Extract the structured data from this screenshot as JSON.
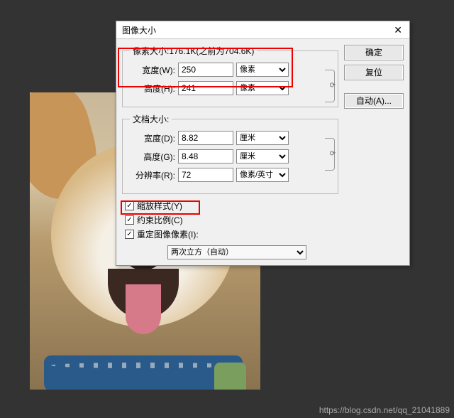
{
  "dialog": {
    "title": "图像大小",
    "close": "✕",
    "pixel_group_legend": "像素大小:176.1K(之前为704.6K)",
    "doc_group_legend": "文档大小:",
    "width_label": "宽度(W):",
    "height_label": "高度(H):",
    "width_val": "250",
    "height_val": "241",
    "px_unit": "像素",
    "doc_width_label": "宽度(D):",
    "doc_height_label": "高度(G):",
    "res_label": "分辨率(R):",
    "doc_width_val": "8.82",
    "doc_height_val": "8.48",
    "res_val": "72",
    "cm_unit": "厘米",
    "res_unit": "像素/英寸",
    "scale_styles": "缩放样式(Y)",
    "constrain": "约束比例(C)",
    "resample": "重定图像像素(I):",
    "method": "两次立方（自动）",
    "ok": "确定",
    "reset": "复位",
    "auto": "自动(A)..."
  },
  "watermark": "https://blog.csdn.net/qq_21041889"
}
